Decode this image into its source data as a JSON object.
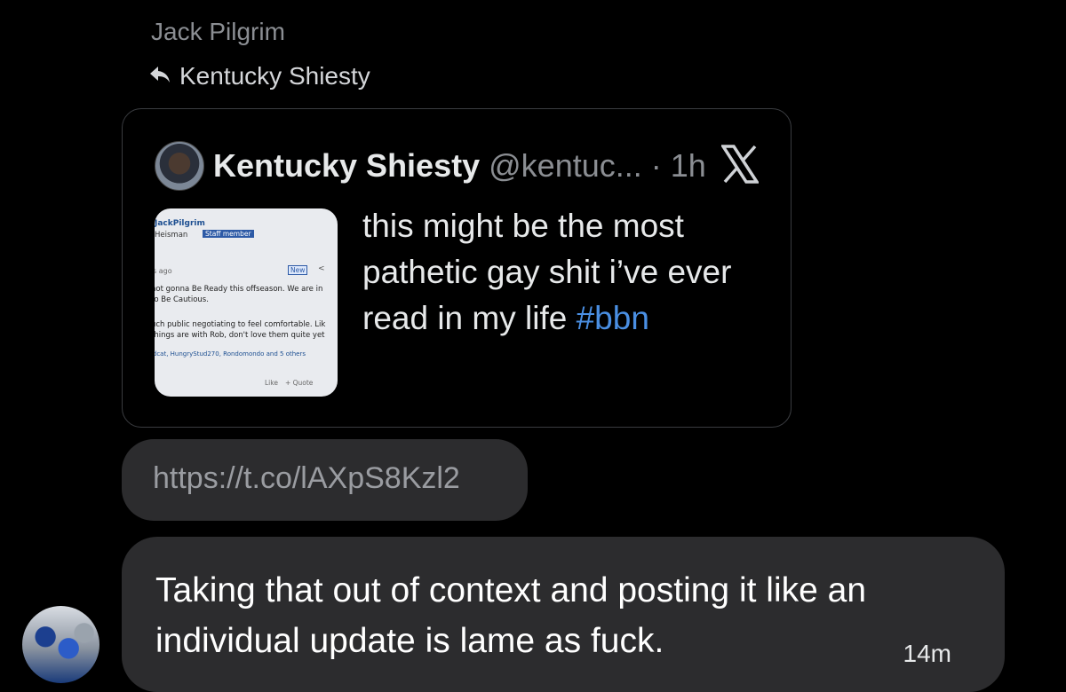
{
  "thread": {
    "sender_name": "Jack Pilgrim",
    "reply_to": "Kentucky Shiesty"
  },
  "quoted_post": {
    "display_name": "Kentucky Shiesty",
    "handle_time": "@kentuc... · 1h",
    "text": "this might be the most pathetic gay shit i’ve ever read in my life",
    "hashtag": "#bbn",
    "x_logo_icon": "x-logo-icon",
    "media": {
      "name": "JackPilgrim",
      "role": "Heisman",
      "badge": "Staff member",
      "ago": "s ago",
      "new": "New",
      "share": "<",
      "line1": "not gonna Be Ready this offseason. We are in",
      "line2": "to Be Cautious.",
      "line3": "uch public negotiating to feel comfortable. Lik",
      "line4": " things are with Rob, don't love them quite yet",
      "reactors": "ildcat, HungryStud270, Rondomondo and 5 others",
      "like": "Like",
      "quote": "+ Quote"
    }
  },
  "link_message": {
    "url": "https://t.co/lAXpS8Kzl2"
  },
  "message": {
    "text": "Taking that out of context and posting it like an individual update is lame as fuck.",
    "time": "14m"
  },
  "colors": {
    "background": "#000000",
    "bubble": "#2c2c2e",
    "hashtag": "#4a8fe3"
  }
}
